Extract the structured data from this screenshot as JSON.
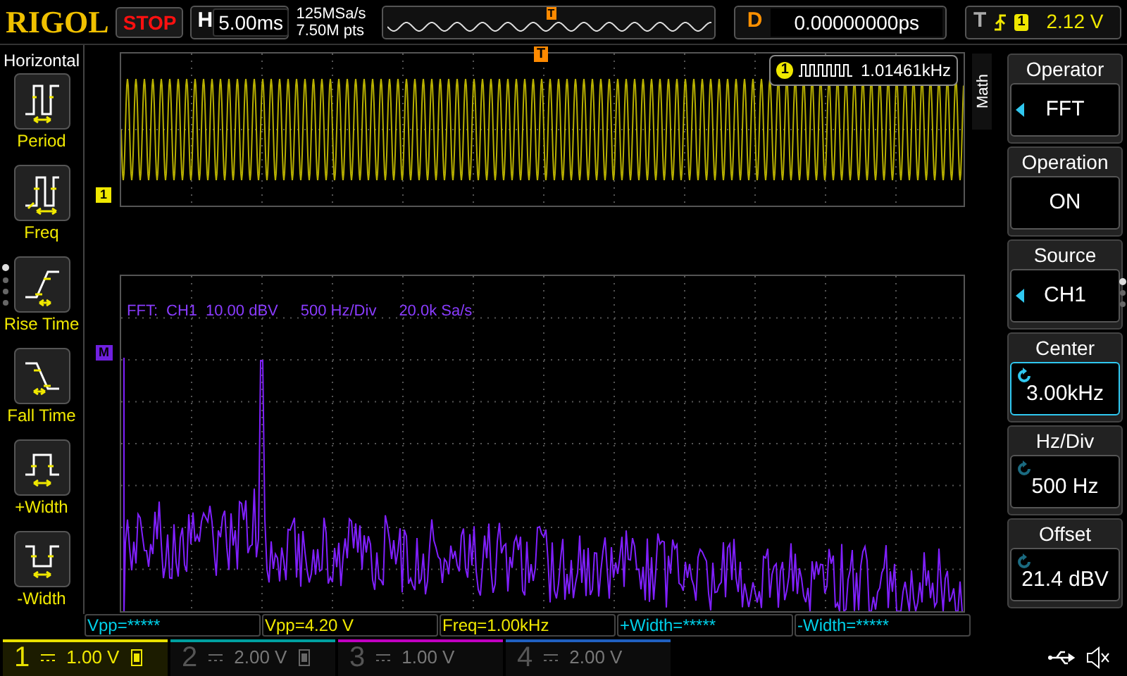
{
  "header": {
    "logo": "RIGOL",
    "run_state": "STOP",
    "timebase_label": "H",
    "timebase": "5.00ms",
    "sample_rate": "125MSa/s",
    "memory_depth": "7.50M pts",
    "overview_trigger": "T",
    "delay_label": "D",
    "delay": "0.00000000ps",
    "trigger_label": "T",
    "trigger_channel": "1",
    "trigger_level": "2.12 V"
  },
  "left_menu": {
    "title": "Horizontal",
    "items": [
      {
        "label": "Period",
        "kind": "period"
      },
      {
        "label": "Freq",
        "kind": "freq"
      },
      {
        "label": "Rise Time",
        "kind": "rise"
      },
      {
        "label": "Fall Time",
        "kind": "fall"
      },
      {
        "label": "+Width",
        "kind": "pwidth"
      },
      {
        "label": "-Width",
        "kind": "nwidth"
      }
    ]
  },
  "waveform": {
    "channel_marker": "1",
    "trigger_marker": "T",
    "counter_channel": "1",
    "counter_value": "1.01461kHz"
  },
  "fft": {
    "info": [
      "FFT:",
      "CH1",
      "10.00 dBV",
      "500 Hz/Div",
      "20.0k Sa/s"
    ],
    "marker": "M"
  },
  "measurements": [
    {
      "text": "Vpp=*****",
      "color": "#00d0e8"
    },
    {
      "text": "Vpp=4.20 V",
      "color": "#f0e800"
    },
    {
      "text": "Freq=1.00kHz",
      "color": "#f0e800"
    },
    {
      "text": "+Width=*****",
      "color": "#00d0e8"
    },
    {
      "text": "-Width=*****",
      "color": "#00d0e8"
    }
  ],
  "channels": [
    {
      "number": "1",
      "scale": "1.00 V",
      "on": true,
      "color": "#e8e000",
      "badge": true
    },
    {
      "number": "2",
      "scale": "2.00 V",
      "on": false,
      "color": "#00a0a0",
      "badge": true
    },
    {
      "number": "3",
      "scale": "1.00 V",
      "on": false,
      "color": "#c000c0",
      "badge": false
    },
    {
      "number": "4",
      "scale": "2.00 V",
      "on": false,
      "color": "#2060c0",
      "badge": false
    }
  ],
  "right_menu": {
    "tab": "Math",
    "items": [
      {
        "label": "Operator",
        "value": "FFT",
        "kind": "select",
        "selected": false
      },
      {
        "label": "Operation",
        "value": "ON",
        "kind": "toggle",
        "selected": false
      },
      {
        "label": "Source",
        "value": "CH1",
        "kind": "select",
        "selected": false
      },
      {
        "label": "Center",
        "value": "3.00kHz",
        "kind": "knob",
        "selected": true
      },
      {
        "label": "Hz/Div",
        "value": "500 Hz",
        "kind": "knob",
        "selected": false
      },
      {
        "label": "Offset",
        "value": "21.4 dBV",
        "kind": "knob",
        "selected": false
      }
    ]
  }
}
